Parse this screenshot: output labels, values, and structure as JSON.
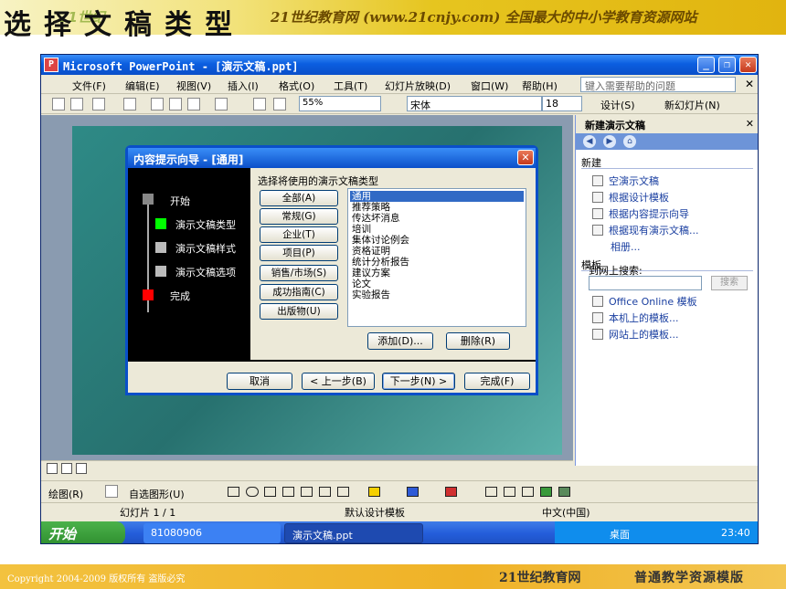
{
  "slide_header": {
    "title": "选择文稿类型",
    "site": "21世纪教育网 (www.21cnjy.com) 全国最大的中小学教育资源网站",
    "logo_text": "21世纪"
  },
  "slide_footer": {
    "copyright": "Copyright 2004-2009 版权所有 盗版必究",
    "site": "21世纪教育网",
    "template": "普通教学资源模版"
  },
  "window": {
    "title": "Microsoft PowerPoint - [演示文稿.ppt]",
    "icon": "P",
    "controls": {
      "minimize": "_",
      "restore": "❐",
      "close": "✕"
    }
  },
  "menu": {
    "items": [
      "文件(F)",
      "编辑(E)",
      "视图(V)",
      "插入(I)",
      "格式(O)",
      "工具(T)",
      "幻灯片放映(D)",
      "窗口(W)",
      "帮助(H)"
    ],
    "help_placeholder": "键入需要帮助的问题",
    "close": "✕"
  },
  "toolbar": {
    "zoom": "55%",
    "font": "宋体",
    "size": "18",
    "design_label": "设计(S)",
    "new_slide_label": "新幻灯片(N)"
  },
  "taskpane": {
    "title": "新建演示文稿",
    "close": "✕",
    "nav": [
      "◀",
      "▶",
      "⌂"
    ],
    "new_section": "新建",
    "new_links": [
      "空演示文稿",
      "根据设计模板",
      "根据内容提示向导",
      "根据现有演示文稿...",
      "相册..."
    ],
    "template_section": "模板",
    "search_label": "到网上搜索:",
    "search_button": "搜索",
    "template_links": [
      "Office Online 模板",
      "本机上的模板...",
      "网站上的模板..."
    ]
  },
  "dialog": {
    "title": "内容提示向导 - [通用]",
    "close": "✕",
    "steps": [
      "开始",
      "演示文稿类型",
      "演示文稿样式",
      "演示文稿选项",
      "完成"
    ],
    "prompt": "选择将使用的演示文稿类型",
    "categories": [
      "全部(A)",
      "常规(G)",
      "企业(T)",
      "项目(P)",
      "销售/市场(S)",
      "成功指南(C)",
      "出版物(U)"
    ],
    "list_items": [
      "通用",
      "推荐策略",
      "传达坏消息",
      "培训",
      "集体讨论例会",
      "资格证明",
      "统计分析报告",
      "建议方案",
      "论文",
      "实验报告"
    ],
    "selected_item": "通用",
    "add_button": "添加(D)...",
    "delete_button": "删除(R)",
    "cancel_button": "取消",
    "back_button": "< 上一步(B)",
    "next_button": "下一步(N) >",
    "finish_button": "完成(F)"
  },
  "drawbar": {
    "draw_label": "绘图(R)",
    "autoshape_label": "自选图形(U)"
  },
  "statusbar": {
    "slide": "幻灯片 1 / 1",
    "design": "默认设计模板",
    "language": "中文(中国)"
  },
  "taskbar": {
    "start": "开始",
    "tasks": [
      "81080906",
      "演示文稿.ppt"
    ],
    "desktop": "桌面",
    "time": "23:40"
  },
  "colors": {
    "xp_blue": "#0a4fc9",
    "selected": "#316ac5",
    "slide_teal": "#2e8a86",
    "step_current": "#00ff00",
    "step_done": "#ff0000"
  }
}
